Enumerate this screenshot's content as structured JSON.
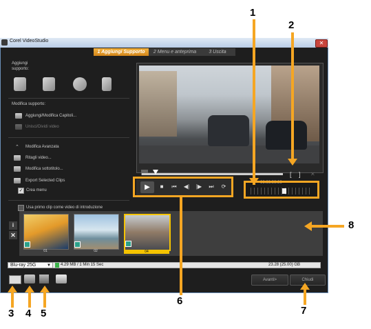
{
  "window": {
    "title": "Corel VideoStudio",
    "close_glyph": "✕"
  },
  "steps": [
    {
      "label": "1 Aggiungi Supporto",
      "active": true
    },
    {
      "label": "2 Menu e anteprima",
      "active": false
    },
    {
      "label": "3 Uscita",
      "active": false
    }
  ],
  "left_panel": {
    "add_media_label": "Aggiungi",
    "add_media_label2": "supporto:",
    "edit_media_label": "Modifica supporto:",
    "add_chapters": "Aggiungi/Modifica Capitoli...",
    "multi_trim": "Unisci/Dividi video",
    "advanced_edit": "Modifica Avanzata",
    "trim_video": "Ritagli video...",
    "edit_subtitle": "Modifica sottotitolo...",
    "export_clips": "Export Selected Clips",
    "create_menu": "Crea menu",
    "use_first_clip": "Usa primo clip come video di introduzione"
  },
  "preview": {
    "mark_in": "[",
    "mark_out": "]",
    "mark_x": "✕",
    "timecode": "00:00:00:00"
  },
  "controls": {
    "play": "▶",
    "stop": "■",
    "home": "⏮",
    "prev": "◀|",
    "next": "|▶",
    "end": "⏭",
    "repeat": "⟳"
  },
  "clips": [
    {
      "label": "01"
    },
    {
      "label": "02"
    },
    {
      "label": "04"
    }
  ],
  "side_buttons": {
    "info": "i",
    "remove": "✕"
  },
  "status": {
    "disc_type": "Blu-ray 25G",
    "size_info": "4.29 MB / 1 Min 15 Sec",
    "capacity": "23.28 (25.00) GB"
  },
  "buttons": {
    "next": "Avanti>",
    "close": "Chiudi"
  },
  "callouts": [
    "1",
    "2",
    "3",
    "4",
    "5",
    "6",
    "7",
    "8"
  ],
  "colors": {
    "callout_orange": "#f5a623",
    "step_active": "#e09a2a",
    "clip_selected": "#f5c400"
  },
  "icons": [
    "add-video-icon",
    "add-dvd-video-icon",
    "add-disc-icon",
    "add-mobile-icon",
    "project-settings-icon",
    "chapter-icon",
    "print-icon"
  ]
}
